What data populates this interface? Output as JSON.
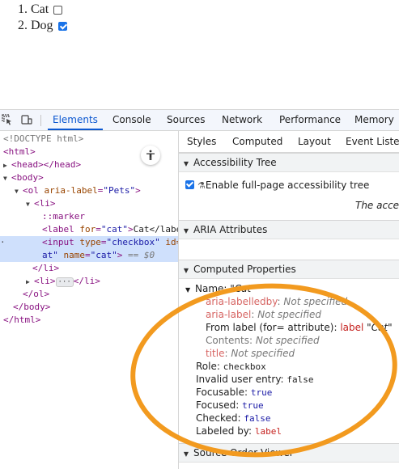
{
  "page": {
    "items": [
      {
        "num": "1.",
        "label": "Cat",
        "checked": false
      },
      {
        "num": "2.",
        "label": "Dog",
        "checked": true
      }
    ]
  },
  "devtools": {
    "icons": [
      "inspect-icon",
      "device-toolbar-icon"
    ],
    "tabs": [
      "Elements",
      "Console",
      "Sources",
      "Network",
      "Performance",
      "Memory"
    ],
    "active_tab": "Elements",
    "dom": {
      "doctype": "<!DOCTYPE html>",
      "html_open": "<html>",
      "head": "<head></head>",
      "body_open": "<body>",
      "ol_tag": "<ol",
      "ol_attr": "aria-label",
      "ol_val": "\"Pets\"",
      "li_open": "<li>",
      "marker": "::marker",
      "label_tag": "<label",
      "label_attr": "for",
      "label_val": "\"cat\"",
      "label_text": "Cat</labe",
      "input_tag": "<input",
      "input_attr1": "type",
      "input_val1": "\"checkbox\"",
      "input_attr2_partial": "id=",
      "input_line2_pre": "at\"",
      "input_attr3": "name",
      "input_val3": "\"cat\"",
      "input_close": ">",
      "eq0": "== $0",
      "li_close": "</li>",
      "li_collapsed_open": "<li>",
      "li_collapsed_ellipsis": "···",
      "li_collapsed_close": "</li>",
      "ol_close": "</ol>",
      "body_close": "</body>",
      "html_close": "</html>"
    },
    "sidebar": {
      "tabs": [
        "Styles",
        "Computed",
        "Layout",
        "Event Listen"
      ],
      "sections": {
        "accessibility_tree": "Accessibility Tree",
        "aria_attributes": "ARIA Attributes",
        "computed_properties": "Computed Properties",
        "source_order": "Source Order Viewer"
      },
      "enable_full_page": "Enable full-page accessibility tree",
      "truncated_note": "The acces",
      "name_label": "Name: ",
      "name_value": "\"Cat\"",
      "labelledby_key": "aria-labelledby",
      "labelledby_val": "Not specified",
      "arialabel_key": "aria-label",
      "arialabel_val": "Not specified",
      "from_label_text": "From label (for= attribute): ",
      "from_label_tag": "label",
      "from_label_val": "\"Cat\"",
      "contents_key": "Contents",
      "contents_val": "Not specified",
      "title_key": "title",
      "title_val": "Not specified",
      "role_key": "Role: ",
      "role_val": "checkbox",
      "invalid_key": "Invalid user entry: ",
      "invalid_val": "false",
      "focusable_key": "Focusable: ",
      "focusable_val": "true",
      "focused_key": "Focused: ",
      "focused_val": "true",
      "checked_key": "Checked: ",
      "checked_val": "false",
      "labeledby_key": "Labeled by: ",
      "labeledby_val": "label"
    }
  },
  "colors": {
    "accent_blue": "#0b57d0",
    "annotation_orange": "#f29a1f"
  }
}
